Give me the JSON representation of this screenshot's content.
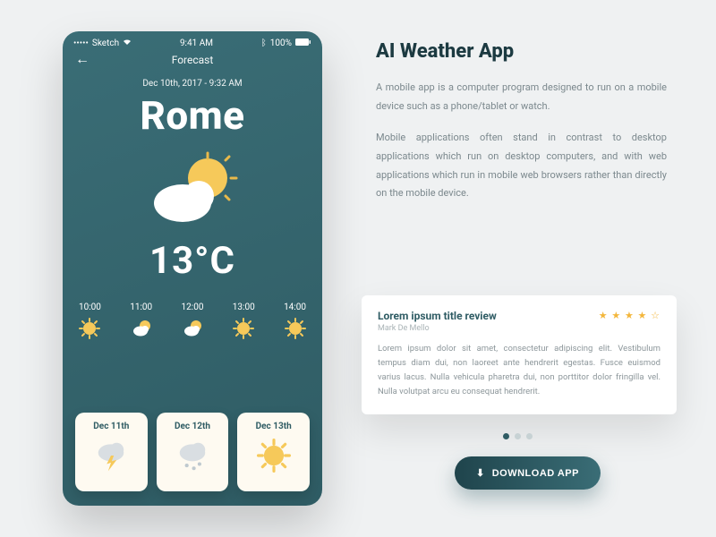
{
  "phone": {
    "statusbar": {
      "carrier": "Sketch",
      "time": "9:41 AM",
      "battery": "100%"
    },
    "nav": {
      "title": "Forecast"
    },
    "dateLine": "Dec 10th, 2017 - 9:32 AM",
    "city": "Rome",
    "temp": "13°C",
    "hourly": [
      {
        "time": "10:00",
        "icon": "sunny"
      },
      {
        "time": "11:00",
        "icon": "partly"
      },
      {
        "time": "12:00",
        "icon": "partly"
      },
      {
        "time": "13:00",
        "icon": "sunny"
      },
      {
        "time": "14:00",
        "icon": "sunny"
      }
    ],
    "daily": [
      {
        "date": "Dec 11th",
        "icon": "thunder"
      },
      {
        "date": "Dec 12th",
        "icon": "snow"
      },
      {
        "date": "Dec 13th",
        "icon": "sunny"
      }
    ]
  },
  "right": {
    "headline": "AI Weather App",
    "para1": "A mobile app is a computer program designed to run on a mobile device such as a phone/tablet or watch.",
    "para2": "Mobile applications often stand in contrast to desktop applications which run on desktop computers, and with web applications which run in mobile web browsers rather than directly on the mobile device."
  },
  "review": {
    "title": "Lorem ipsum title review",
    "author": "Mark De Mello",
    "rating": 4,
    "body": "Lorem ipsum dolor sit amet, consectetur adipiscing elit. Vestibulum tempus diam dui, non laoreet ante hendrerit egestas. Fusce euismod varius lacus. Nulla vehicula pharetra dui, non porttitor dolor fringilla vel. Nulla volutpat arcu eu consequat hendrerit."
  },
  "carousel": {
    "activeIndex": 0,
    "count": 3
  },
  "cta": {
    "label": "DOWNLOAD APP"
  }
}
